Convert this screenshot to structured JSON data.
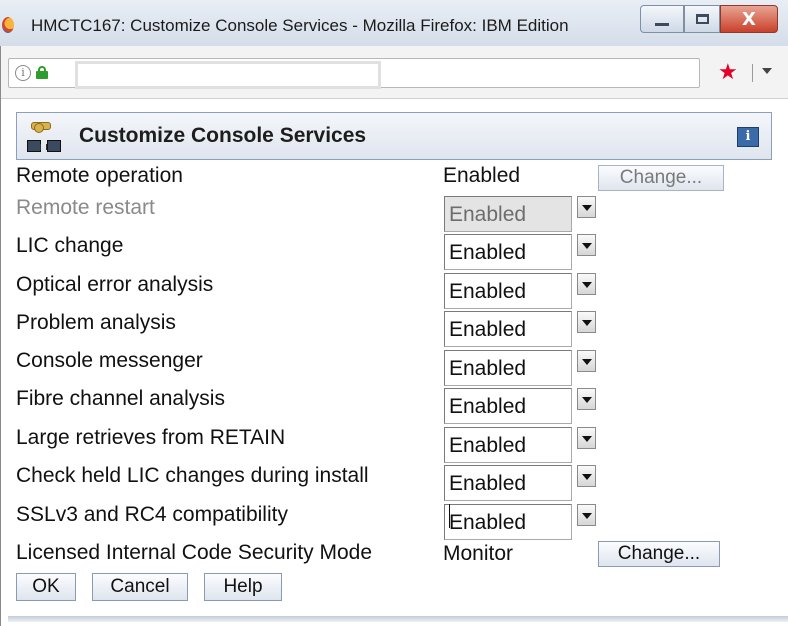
{
  "window": {
    "title": "HMCTC167: Customize Console Services - Mozilla Firefox: IBM Edition",
    "close_glyph": "X"
  },
  "navbar": {
    "info_glyph": "i",
    "star_glyph": "★"
  },
  "header": {
    "title": "Customize Console Services",
    "help_glyph": "i"
  },
  "settings": {
    "remote_operation": {
      "label": "Remote operation",
      "value": "Enabled",
      "button": "Change..."
    },
    "remote_restart": {
      "label": "Remote restart",
      "value": "Enabled"
    },
    "lic_change": {
      "label": "LIC change",
      "value": "Enabled"
    },
    "optical_error": {
      "label": "Optical error analysis",
      "value": "Enabled"
    },
    "problem_analysis": {
      "label": "Problem analysis",
      "value": "Enabled"
    },
    "console_messenger": {
      "label": "Console messenger",
      "value": "Enabled"
    },
    "fibre_channel": {
      "label": "Fibre channel analysis",
      "value": "Enabled"
    },
    "large_retrieves": {
      "label": "Large retrieves from RETAIN",
      "value": "Enabled"
    },
    "check_held_lic": {
      "label": "Check held LIC changes during install",
      "value": "Enabled"
    },
    "sslv3_rc4": {
      "label": "SSLv3 and RC4 compatibility",
      "value": "Enabled"
    },
    "lic_security_mode": {
      "label": "Licensed Internal Code Security Mode",
      "value": "Monitor",
      "button": "Change..."
    }
  },
  "buttons": {
    "ok": "OK",
    "cancel": "Cancel",
    "help": "Help"
  }
}
